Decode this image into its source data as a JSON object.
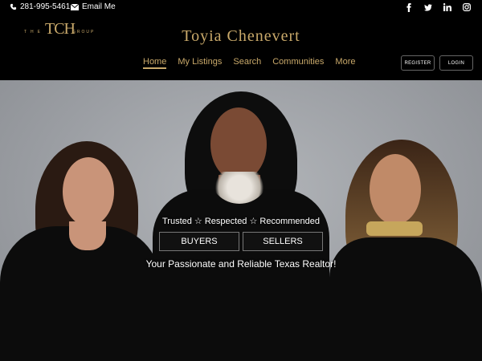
{
  "topbar": {
    "phone": "281-995-5461",
    "email_label": "Email Me",
    "social_icons": [
      "facebook-icon",
      "twitter-icon",
      "linkedin-icon",
      "instagram-icon"
    ]
  },
  "header": {
    "logo": {
      "monogram": "TCH",
      "left_word": "THE",
      "right_word": "GROUP"
    },
    "site_title": "Toyia Chenevert",
    "nav": [
      "Home",
      "My Listings",
      "Search",
      "Communities",
      "More"
    ],
    "active_nav": "Home",
    "register_label": "REGISTER",
    "login_label": "LOGIN"
  },
  "hero": {
    "tagline": "Trusted ☆ Respected ☆ Recommended",
    "buyers_label": "BUYERS",
    "sellers_label": "SELLERS",
    "subline": "Your Passionate and Reliable Texas Realtor!"
  },
  "colors": {
    "gold": "#c9a96a",
    "background": "#000000",
    "hero_gray": "#9c9fa4"
  }
}
